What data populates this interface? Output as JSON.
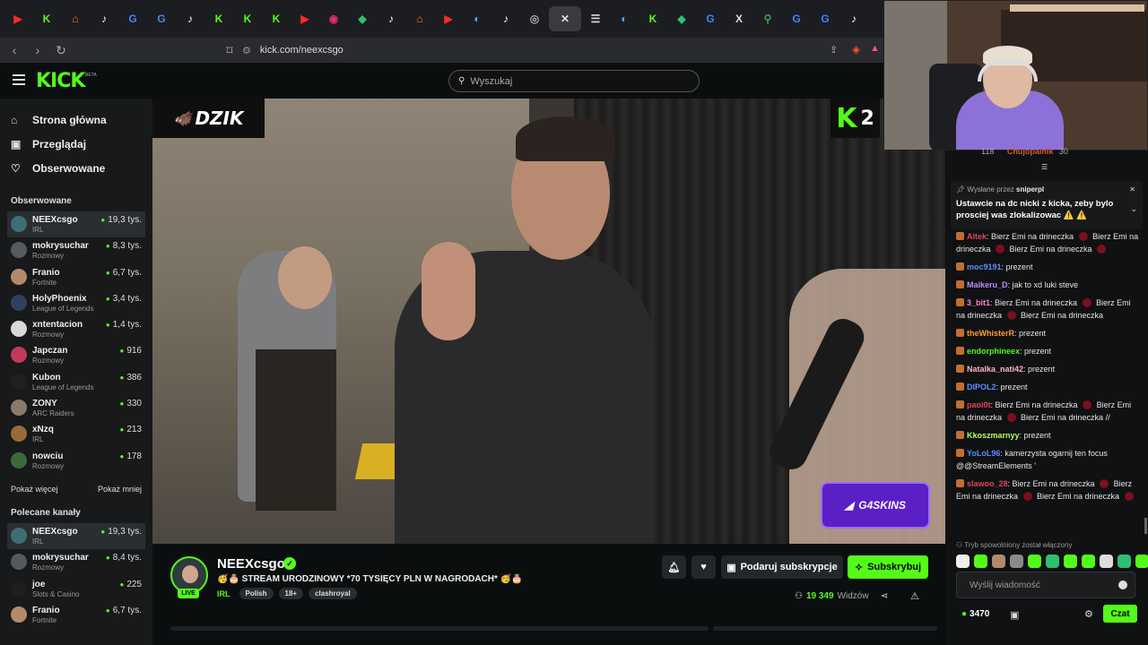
{
  "browser": {
    "tabs": [
      {
        "icon": "▶",
        "color": "#ff2a2a"
      },
      {
        "icon": "K",
        "color": "#53fc18"
      },
      {
        "icon": "⌂",
        "color": "#f07a3c"
      },
      {
        "icon": "♪",
        "color": "#ffffff"
      },
      {
        "icon": "G",
        "color": "#4285f4"
      },
      {
        "icon": "G",
        "color": "#4285f4"
      },
      {
        "icon": "♪",
        "color": "#ffffff"
      },
      {
        "icon": "K",
        "color": "#53fc18"
      },
      {
        "icon": "K",
        "color": "#53fc18"
      },
      {
        "icon": "K",
        "color": "#53fc18"
      },
      {
        "icon": "▶",
        "color": "#ff2a2a"
      },
      {
        "icon": "◉",
        "color": "#e1306c"
      },
      {
        "icon": "◆",
        "color": "#2fbf71"
      },
      {
        "icon": "♪",
        "color": "#ffffff"
      },
      {
        "icon": "⌂",
        "color": "#f07a3c"
      },
      {
        "icon": "▶",
        "color": "#ff2a2a"
      },
      {
        "icon": "◐",
        "color": "#5fa8ff"
      },
      {
        "icon": "♪",
        "color": "#ffffff"
      },
      {
        "icon": "◎",
        "color": "#aaaaaa"
      },
      {
        "icon": "✕",
        "color": "#dddddd",
        "active": true
      },
      {
        "icon": "☰",
        "color": "#dddddd"
      },
      {
        "icon": "◐",
        "color": "#5fa8ff"
      },
      {
        "icon": "K",
        "color": "#53fc18"
      },
      {
        "icon": "◆",
        "color": "#2fbf71"
      },
      {
        "icon": "G",
        "color": "#4285f4"
      },
      {
        "icon": "X",
        "color": "#dddddd"
      },
      {
        "icon": "⚲",
        "color": "#34a853"
      },
      {
        "icon": "G",
        "color": "#4285f4"
      },
      {
        "icon": "G",
        "color": "#4285f4"
      },
      {
        "icon": "♪",
        "color": "#ffffff"
      }
    ],
    "url": "kick.com/neexcsgo"
  },
  "header": {
    "logo": "KICK",
    "logo_badge": "BETA",
    "search_placeholder": "Wyszukaj"
  },
  "sidebar": {
    "nav": [
      {
        "icon": "⌂",
        "label": "Strona główna"
      },
      {
        "icon": "▣",
        "label": "Przeglądaj"
      },
      {
        "icon": "♡",
        "label": "Obserwowane"
      }
    ],
    "followed_title": "Obserwowane",
    "followed": [
      {
        "name": "NEEXcsgo",
        "category": "IRL",
        "viewers": "19,3 tys.",
        "color": "#3b6f74",
        "active": true
      },
      {
        "name": "mokrysuchar",
        "category": "Rozmowy",
        "viewers": "8,3 tys.",
        "color": "#555a60"
      },
      {
        "name": "Franio",
        "category": "Fortnite",
        "viewers": "6,7 tys.",
        "color": "#b58a6a"
      },
      {
        "name": "HolyPhoenix",
        "category": "League of Legends",
        "viewers": "3,4 tys.",
        "color": "#304060"
      },
      {
        "name": "xntentacion",
        "category": "Rozmowy",
        "viewers": "1,4 tys.",
        "color": "#d8d8d8"
      },
      {
        "name": "Japczan",
        "category": "Rozmowy",
        "viewers": "916",
        "color": "#c03a5a"
      },
      {
        "name": "Kubon",
        "category": "League of Legends",
        "viewers": "386",
        "color": "#202020"
      },
      {
        "name": "ZONY",
        "category": "ARC Raiders",
        "viewers": "330",
        "color": "#8a7a6a"
      },
      {
        "name": "xNzq",
        "category": "IRL",
        "viewers": "213",
        "color": "#9a6a3a"
      },
      {
        "name": "nowciu",
        "category": "Rozmowy",
        "viewers": "178",
        "color": "#3a6a3a"
      }
    ],
    "show_more": "Pokaż więcej",
    "show_less": "Pokaż mniej",
    "recommended_title": "Polecane kanały",
    "recommended": [
      {
        "name": "NEEXcsgo",
        "category": "IRL",
        "viewers": "19,3 tys.",
        "color": "#3b6f74",
        "active": true
      },
      {
        "name": "mokrysuchar",
        "category": "Rozmowy",
        "viewers": "8,4 tys.",
        "color": "#555a60"
      },
      {
        "name": "joe",
        "category": "Slots & Casino",
        "viewers": "225",
        "color": "#1e1e1e"
      },
      {
        "name": "Franio",
        "category": "Fortnite",
        "viewers": "6,7 tys.",
        "color": "#b58a6a"
      }
    ]
  },
  "video": {
    "overlay_brand": "DZIK",
    "overlay_k": "2",
    "overlay_sponsor": "G4SKINS"
  },
  "stream": {
    "channel": "NEEXcsgo",
    "live": "LIVE",
    "title": "🥳🎂 STREAM URODZINOWY *70 TYSIĘCY PLN W NAGRODACH* 🥳🎂",
    "category": "IRL",
    "tags": [
      "Polish",
      "18+",
      "clashroyal"
    ],
    "viewers": "19 349",
    "viewers_label": "Widzów",
    "gift_label": "Podaruj subskrypcje",
    "subscribe_label": "Subskrybuj"
  },
  "chat": {
    "top_user": "Chujopalnik",
    "top_count": "118",
    "top_count2": "30",
    "pinned_by_label": "Wysłane przez",
    "pinned_by": "sniperpl",
    "pinned_message": "Ustawcie na dc nicki z kicka, zeby bylo prosciej was zlokalizowac ⚠️ ⚠️",
    "messages": [
      {
        "user": "Altek",
        "color": "#e0435a",
        "text": ": Bierz Emi na drineczka [e] Bierz Emi na drineczka [e] Bierz Emi na drineczka [e]"
      },
      {
        "user": "moc9191",
        "color": "#5f8cff",
        "text": ": prezent"
      },
      {
        "user": "Maikeru_D",
        "color": "#b78cff",
        "text": ": jak to xd luki steve"
      },
      {
        "user": "3_bit1",
        "color": "#ff7fd0",
        "text": ": Bierz Emi na drineczka [e] Bierz Emi na drineczka [e] Bierz Emi na drineczka"
      },
      {
        "user": "theWhisterR",
        "color": "#ff9f2e",
        "text": ": prezent"
      },
      {
        "user": "endorphineex",
        "color": "#53fc18",
        "text": ": prezent"
      },
      {
        "user": "Natalka_nati42",
        "color": "#ffb3c6",
        "text": ": prezent"
      },
      {
        "user": "DIPOL2",
        "color": "#5f8cff",
        "text": ": prezent"
      },
      {
        "user": "paoi0t",
        "color": "#e0435a",
        "text": ": Bierz Emi na drineczka [e] Bierz Emi na drineczka [e] Bierz Emi na drineczka //"
      },
      {
        "user": "Kkoszmarnyy",
        "color": "#b7ff5a",
        "text": ": prezent"
      },
      {
        "user": "YoLoL96",
        "color": "#5f8cff",
        "text": ": kamerzysta ogarnij ten focus @@StreamElements '"
      },
      {
        "user": "slawoo_28",
        "color": "#e0435a",
        "text": ": Bierz Emi na drineczka [e] Bierz Emi na drineczka [e] Bierz Emi na drineczka [e]"
      }
    ],
    "slow_mode": "Tryb spowolniony został włączony",
    "input_placeholder": "Wyślij wiadomość",
    "points": "3470",
    "send_label": "Czat"
  }
}
